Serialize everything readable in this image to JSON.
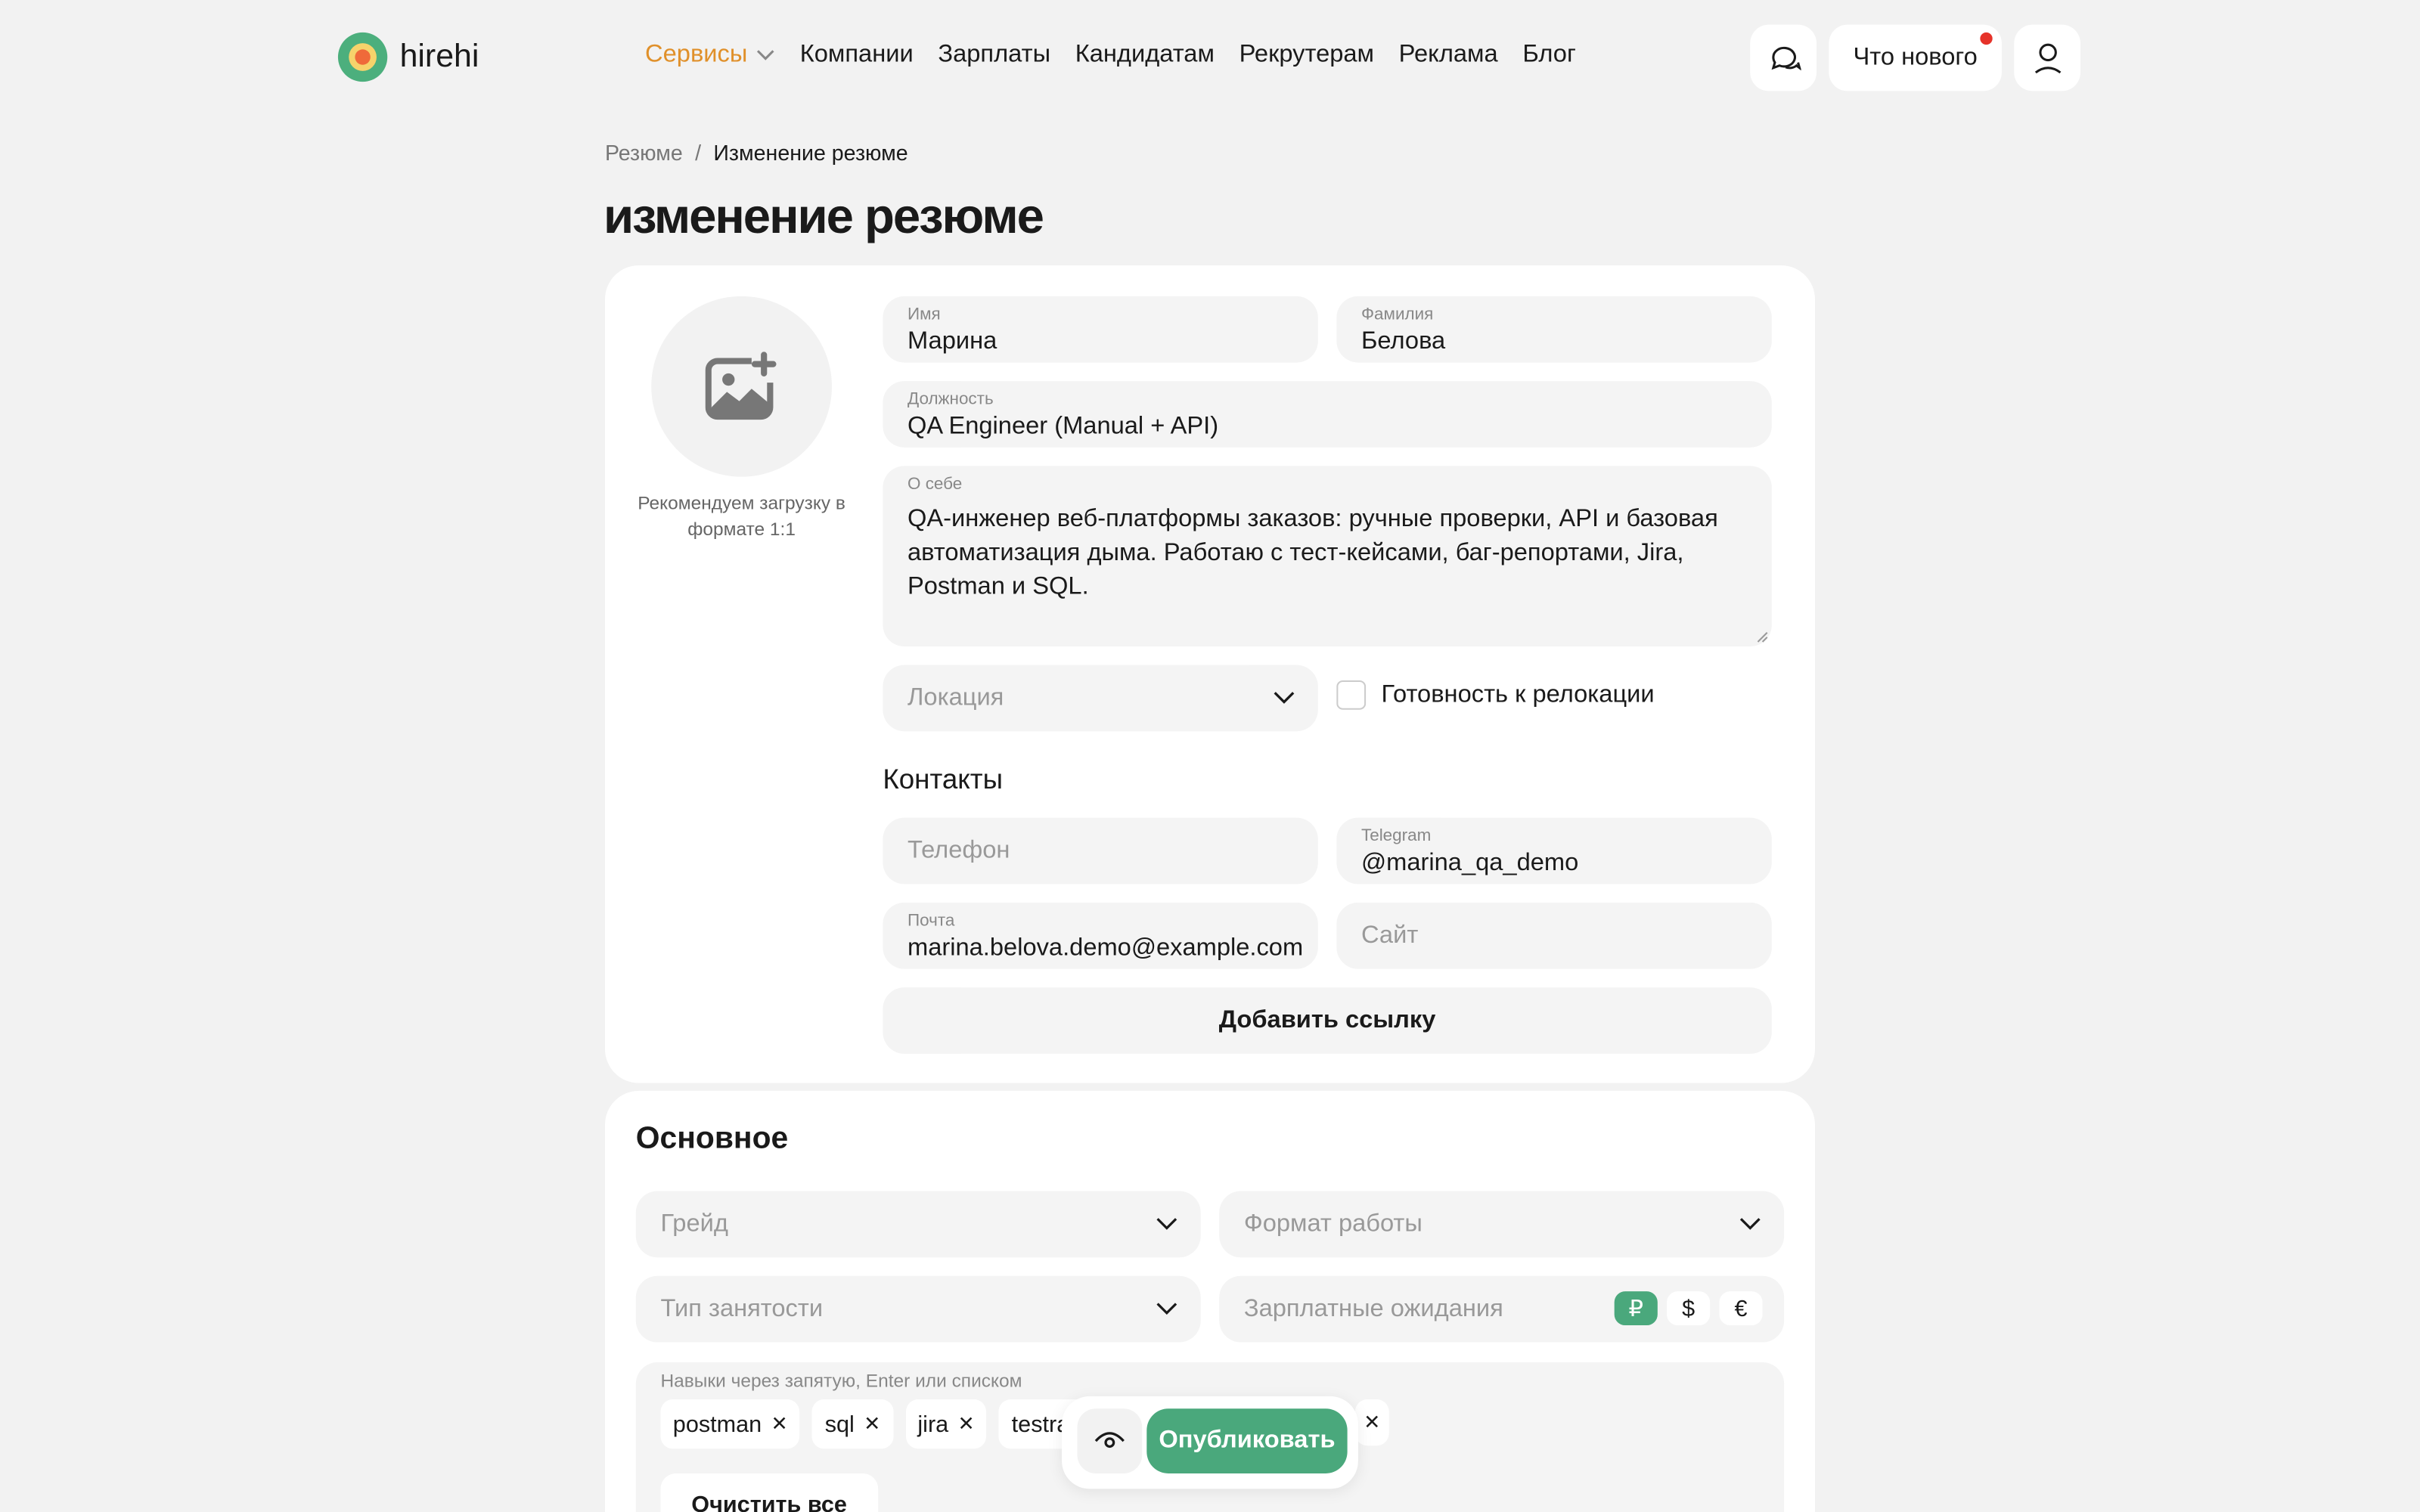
{
  "header": {
    "logo": "hirehi",
    "nav": [
      "Сервисы",
      "Компании",
      "Зарплаты",
      "Кандидатам",
      "Рекрутерам",
      "Реклама",
      "Блог"
    ],
    "whats_new": "Что нового"
  },
  "breadcrumb": {
    "parent": "Резюме",
    "separator": "/",
    "current": "Изменение резюме"
  },
  "page_title": "изменение резюме",
  "profile": {
    "avatar_hint": "Рекомендуем загрузку в формате 1:1",
    "first_name_label": "Имя",
    "first_name": "Марина",
    "last_name_label": "Фамилия",
    "last_name": "Белова",
    "position_label": "Должность",
    "position": "QA Engineer (Manual + API)",
    "about_label": "О себе",
    "about": "QA-инженер веб-платформы заказов: ручные проверки, API и базовая автоматизация дыма. Работаю с тест-кейсами, баг-репортами, Jira, Postman и SQL.",
    "location_placeholder": "Локация",
    "relocation_label": "Готовность к релокации"
  },
  "contacts": {
    "title": "Контакты",
    "phone_placeholder": "Телефон",
    "telegram_label": "Telegram",
    "telegram": "@marina_qa_demo",
    "email_label": "Почта",
    "email": "marina.belova.demo@example.com",
    "site_placeholder": "Сайт",
    "add_link": "Добавить ссылку"
  },
  "main_section": {
    "title": "Основное",
    "grade_placeholder": "Грейд",
    "work_format_placeholder": "Формат работы",
    "employment_placeholder": "Тип занятости",
    "salary_placeholder": "Зарплатные ожидания",
    "currencies": [
      "₽",
      "$",
      "€"
    ],
    "skills_label": "Навыки через запятую, Enter или списком",
    "skills": [
      "postman",
      "sql",
      "jira",
      "testrail"
    ],
    "clear_all": "Очистить все"
  },
  "actions": {
    "publish": "Опубликовать"
  },
  "colors": {
    "accent": "#4aa87c",
    "services": "#e0902a",
    "notification": "#e6332a"
  }
}
